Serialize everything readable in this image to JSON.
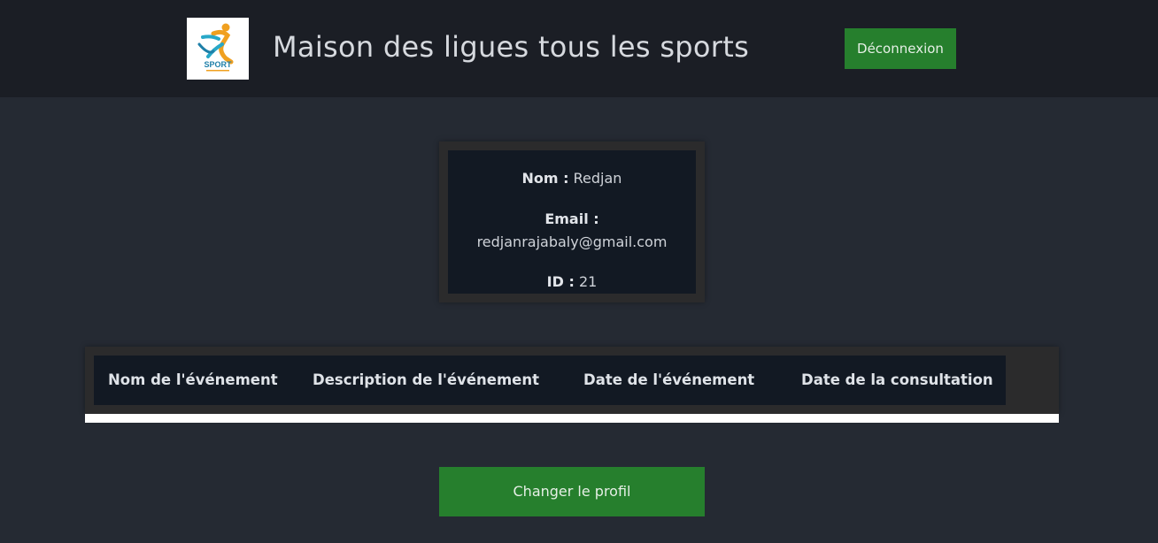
{
  "header": {
    "logo_icon": "sport-runner-logo",
    "logo_text": "SPORT",
    "title": "Maison des ligues tous les sports",
    "logout_label": "Déconnexion"
  },
  "profile": {
    "name_label": "Nom :",
    "name_value": "Redjan",
    "email_label": "Email :",
    "email_value": "redjanrajabaly@gmail.com",
    "id_label": "ID :",
    "id_value": "21"
  },
  "events_table": {
    "columns": [
      "Nom de l'événement",
      "Description de l'événement",
      "Date de l'événement",
      "Date de la consultation"
    ],
    "rows": []
  },
  "actions": {
    "change_profile_label": "Changer le profil"
  },
  "colors": {
    "page_bg": "#252a33",
    "header_bg": "#1b1e25",
    "card_bg": "#121923",
    "card_border": "#2b2b2c",
    "button_green": "#267f2d"
  }
}
